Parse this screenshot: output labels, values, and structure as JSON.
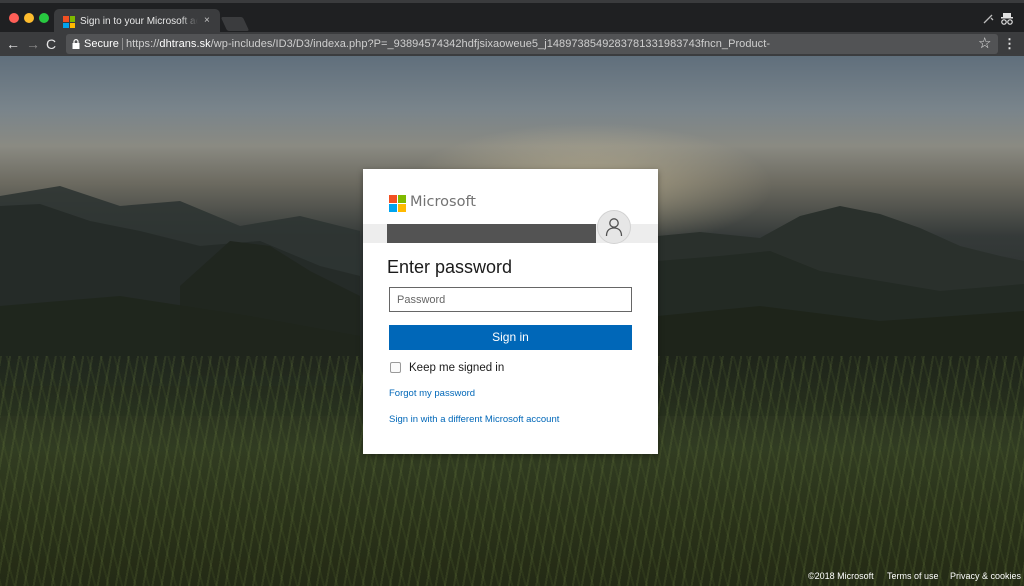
{
  "browser": {
    "tab": {
      "title": "Sign in to your Microsoft account",
      "close_glyph": "×"
    },
    "nav": {
      "back": "←",
      "forward": "→",
      "reload": "C"
    },
    "omnibox": {
      "secure_label": "Secure",
      "url_scheme": "https://",
      "url_host": "dhtrans.sk",
      "url_path": "/wp-includes/ID3/D3/indexa.php?P=_93894574342hdfjsixaoweue5_j1489738549283781331983743fncn_Product-"
    },
    "star_glyph": "☆",
    "menu_glyph": "⋮"
  },
  "login": {
    "brand": "Microsoft",
    "brand_colors": [
      "#f25022",
      "#7fba00",
      "#00a4ef",
      "#ffb900"
    ],
    "title": "Enter password",
    "password_placeholder": "Password",
    "signin_label": "Sign in",
    "keep_signed_in_label": "Keep me signed in",
    "keep_signed_in_checked": false,
    "forgot_link": "Forgot my password",
    "different_account_link": "Sign in with a different Microsoft account",
    "accent_color": "#0067b8"
  },
  "footer": {
    "copyright": "©2018 Microsoft",
    "terms": "Terms of use",
    "privacy": "Privacy & cookies"
  }
}
